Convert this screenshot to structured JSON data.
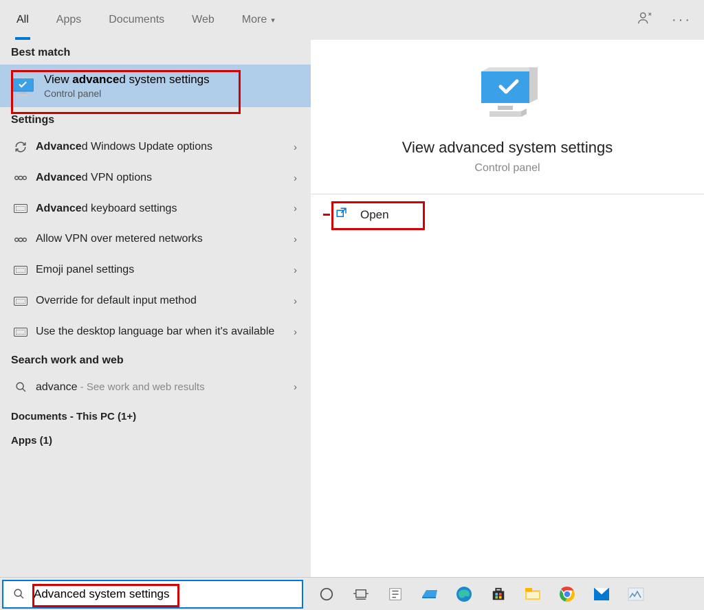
{
  "tabs": {
    "all": "All",
    "apps": "Apps",
    "documents": "Documents",
    "web": "Web",
    "more": "More"
  },
  "sections": {
    "bestMatch": "Best match",
    "settings": "Settings",
    "searchWorkWeb": "Search work and web",
    "documentsThisPc": "Documents - This PC (1+)",
    "appsCount": "Apps (1)"
  },
  "bestMatch": {
    "title_pre": "View ",
    "title_bold": "advance",
    "title_post": "d system settings",
    "sub": "Control panel"
  },
  "settingsItems": [
    {
      "bold": "Advance",
      "rest": "d Windows Update options",
      "icon": "refresh"
    },
    {
      "bold": "Advance",
      "rest": "d VPN options",
      "icon": "vpn"
    },
    {
      "bold": "Advance",
      "rest": "d keyboard settings",
      "icon": "keyboard"
    },
    {
      "bold": "",
      "rest": "Allow VPN over metered networks",
      "icon": "vpn"
    },
    {
      "bold": "",
      "rest": "Emoji panel settings",
      "icon": "keyboard"
    },
    {
      "bold": "",
      "rest": "Override for default input method",
      "icon": "keyboard"
    },
    {
      "bold": "",
      "rest": "Use the desktop language bar when it's available",
      "icon": "keyboard"
    }
  ],
  "webSearch": {
    "query": "advance",
    "suffix": " - See work and web results"
  },
  "preview": {
    "title": "View advanced system settings",
    "sub": "Control panel",
    "open": "Open"
  },
  "search": {
    "value": "Advanced system settings"
  }
}
